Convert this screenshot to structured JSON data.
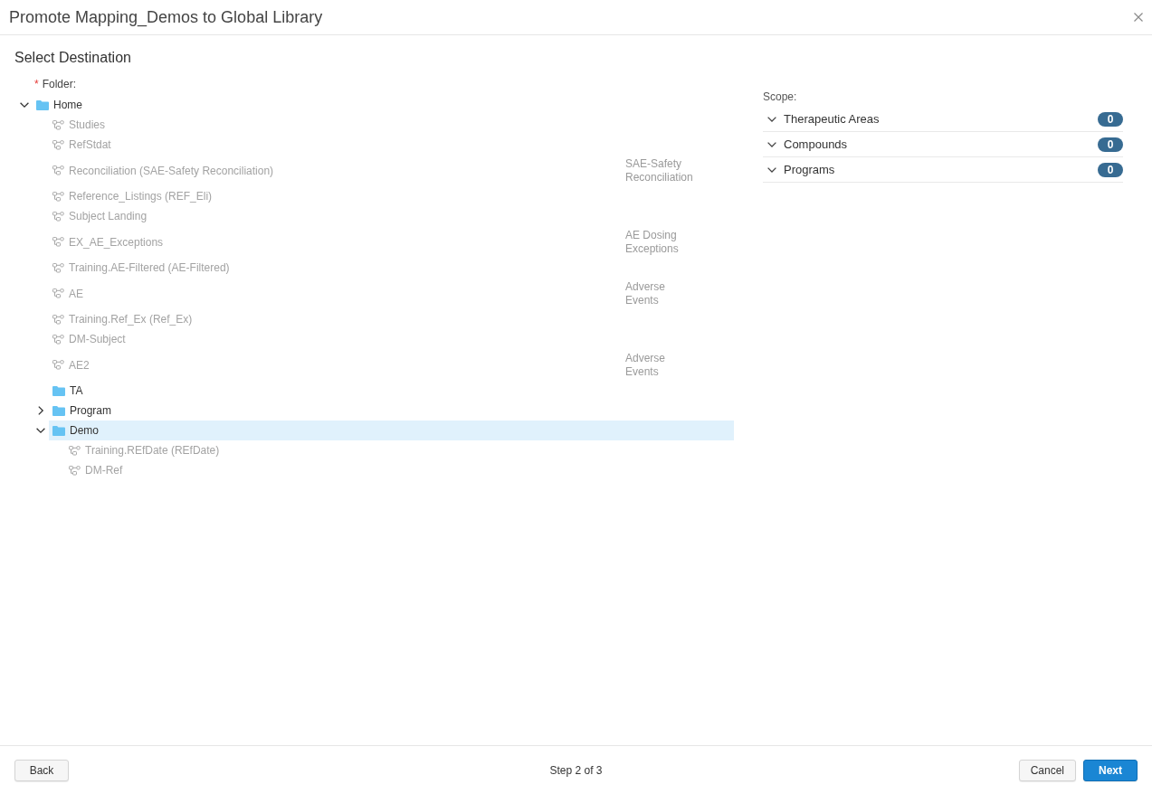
{
  "dialog": {
    "title": "Promote Mapping_Demos to Global Library"
  },
  "heading": "Select Destination",
  "folder_field": {
    "required_mark": "*",
    "label": "Folder:"
  },
  "tree": [
    {
      "kind": "folder",
      "label": "Home",
      "expanded": true,
      "selected": false,
      "children": [
        {
          "kind": "mapping",
          "label": "Studies",
          "selected": false
        },
        {
          "kind": "mapping",
          "label": "RefStdat",
          "selected": false
        },
        {
          "kind": "mapping",
          "label": "Reconciliation (SAE-Safety Reconciliation)",
          "description": "SAE-Safety Reconciliation",
          "selected": false
        },
        {
          "kind": "mapping",
          "label": "Reference_Listings (REF_Eli)",
          "selected": false
        },
        {
          "kind": "mapping",
          "label": "Subject Landing",
          "selected": false
        },
        {
          "kind": "mapping",
          "label": "EX_AE_Exceptions",
          "description": "AE Dosing Exceptions",
          "selected": false
        },
        {
          "kind": "mapping",
          "label": "Training.AE-Filtered (AE-Filtered)",
          "selected": false
        },
        {
          "kind": "mapping",
          "label": "AE",
          "description": "Adverse Events",
          "selected": false
        },
        {
          "kind": "mapping",
          "label": "Training.Ref_Ex (Ref_Ex)",
          "selected": false
        },
        {
          "kind": "mapping",
          "label": "DM-Subject",
          "selected": false
        },
        {
          "kind": "mapping",
          "label": "AE2",
          "description": "Adverse Events",
          "selected": false
        },
        {
          "kind": "folder",
          "label": "TA",
          "selected": false
        },
        {
          "kind": "folder",
          "label": "Program",
          "expanded": false,
          "selected": false
        },
        {
          "kind": "folder",
          "label": "Demo",
          "expanded": true,
          "selected": true,
          "children": [
            {
              "kind": "mapping",
              "label": "Training.REfDate (REfDate)",
              "selected": false
            },
            {
              "kind": "mapping",
              "label": "DM-Ref",
              "selected": false
            }
          ]
        }
      ]
    }
  ],
  "scope": {
    "label": "Scope:",
    "sections": [
      {
        "label": "Therapeutic Areas",
        "count": "0",
        "expanded": false
      },
      {
        "label": "Compounds",
        "count": "0",
        "expanded": false
      },
      {
        "label": "Programs",
        "count": "0",
        "expanded": false
      }
    ]
  },
  "footer": {
    "left_buttons": [
      {
        "label": "Back",
        "kind": "secondary"
      }
    ],
    "step": "Step 2 of 3",
    "right_buttons": [
      {
        "label": "Cancel",
        "kind": "secondary"
      },
      {
        "label": "Next",
        "kind": "primary"
      }
    ]
  }
}
